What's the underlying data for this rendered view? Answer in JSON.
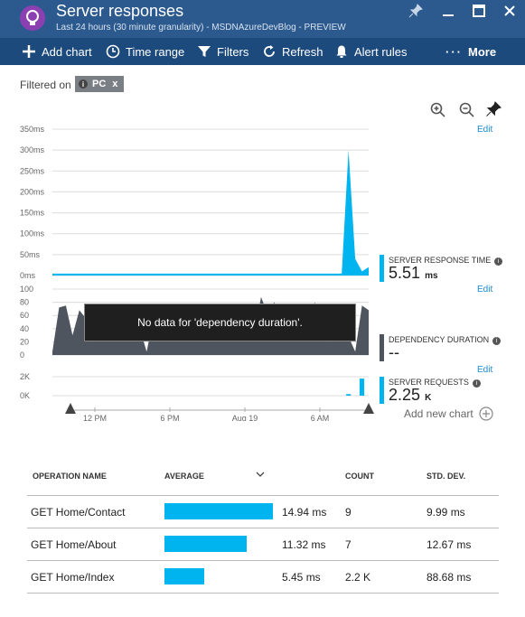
{
  "header": {
    "title": "Server responses",
    "subtitle": "Last 24 hours (30 minute granularity) - MSDNAzureDevBlog - PREVIEW",
    "brand_color": "#2d5a8e",
    "toolbar_color": "#1d4a7d"
  },
  "toolbar": {
    "add_chart": "Add chart",
    "time_range": "Time range",
    "filters": "Filters",
    "refresh": "Refresh",
    "alert_rules": "Alert rules",
    "more": "More"
  },
  "filter": {
    "label": "Filtered on",
    "chip": "PC",
    "chip_close": "x"
  },
  "chart_tools": {
    "edit": "Edit"
  },
  "chart_data": [
    {
      "type": "area",
      "metric": "SERVER RESPONSE TIME",
      "value": "5.51",
      "unit": "ms",
      "yticks": [
        "350ms",
        "300ms",
        "250ms",
        "200ms",
        "150ms",
        "100ms",
        "50ms",
        "0ms"
      ],
      "ylim": [
        0,
        350
      ],
      "values": [
        3,
        3,
        3,
        3,
        3,
        3,
        3,
        3,
        3,
        3,
        3,
        3,
        3,
        3,
        3,
        3,
        3,
        3,
        3,
        3,
        3,
        3,
        3,
        3,
        3,
        3,
        3,
        3,
        3,
        3,
        3,
        3,
        3,
        3,
        3,
        3,
        3,
        3,
        3,
        3,
        3,
        3,
        3,
        5,
        300,
        40,
        10,
        20
      ],
      "color": "#00b4f0"
    },
    {
      "type": "area",
      "metric": "DEPENDENCY DURATION",
      "value": "--",
      "unit": "",
      "yticks": [
        "100",
        "80",
        "60",
        "40",
        "20",
        "0"
      ],
      "ylim": [
        0,
        100
      ],
      "values": [
        5,
        72,
        75,
        30,
        68,
        55,
        20,
        75,
        40,
        60,
        35,
        70,
        65,
        40,
        5,
        55,
        78,
        30,
        72,
        45,
        60,
        40,
        68,
        30,
        55,
        65,
        75,
        50,
        70,
        60,
        30,
        88,
        62,
        80,
        45,
        35,
        70,
        40,
        55,
        80,
        30,
        20,
        75,
        60,
        28,
        5,
        75,
        68
      ],
      "color": "#4f555e",
      "message": "No data for 'dependency duration'."
    },
    {
      "type": "bar",
      "metric": "SERVER REQUESTS",
      "value": "2.25",
      "unit": "K",
      "yticks": [
        "2K",
        "0K"
      ],
      "ylim": [
        0,
        2500
      ],
      "values": [
        0,
        0,
        0,
        0,
        0,
        0,
        0,
        0,
        0,
        0,
        0,
        0,
        0,
        0,
        0,
        0,
        0,
        0,
        0,
        0,
        0,
        0,
        0,
        0,
        0,
        0,
        0,
        0,
        0,
        0,
        0,
        0,
        0,
        0,
        0,
        0,
        0,
        0,
        0,
        0,
        0,
        0,
        0,
        0,
        200,
        0,
        2250,
        0
      ],
      "color": "#00b4f0"
    }
  ],
  "x_axis": {
    "ticks": [
      "12 PM",
      "6 PM",
      "Aug 19",
      "6 AM"
    ]
  },
  "add_new_chart": "Add new chart",
  "table": {
    "columns": [
      "OPERATION NAME",
      "AVERAGE",
      "COUNT",
      "STD. DEV."
    ],
    "sort_column": "AVERAGE",
    "rows": [
      {
        "name": "GET Home/Contact",
        "average": "14.94 ms",
        "average_value": 14.94,
        "count": "9",
        "std_dev": "9.99 ms"
      },
      {
        "name": "GET Home/About",
        "average": "11.32 ms",
        "average_value": 11.32,
        "count": "7",
        "std_dev": "12.67 ms"
      },
      {
        "name": "GET Home/Index",
        "average": "5.45 ms",
        "average_value": 5.45,
        "count": "2.2 K",
        "std_dev": "88.68 ms"
      }
    ],
    "bar_color": "#00b4f0"
  }
}
